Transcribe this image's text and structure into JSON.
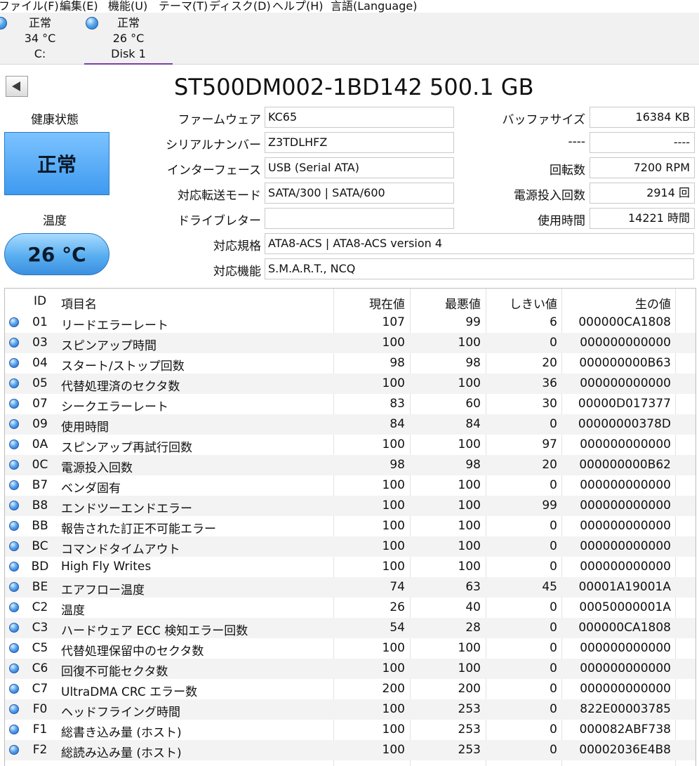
{
  "menu": [
    "ファイル(F)",
    "編集(E)",
    "機能(U)",
    "テーマ(T)",
    "ディスク(D)",
    "ヘルプ(H)",
    "言語(Language)"
  ],
  "disks": [
    {
      "status": "正常",
      "temp": "34 °C",
      "name": "C:"
    },
    {
      "status": "正常",
      "temp": "26 °C",
      "name": "Disk 1"
    }
  ],
  "colors": {
    "accent_tab": "#7a3fa8",
    "health_good": "#3e9af0",
    "status_dot": "#1c5fc2"
  },
  "title": "ST500DM002-1BD142 500.1 GB",
  "health": {
    "label": "健康状態",
    "value": "正常"
  },
  "temperature": {
    "label": "温度",
    "value": "26 °C"
  },
  "info": {
    "firmware": {
      "label": "ファームウェア",
      "value": "KC65"
    },
    "serial": {
      "label": "シリアルナンバー",
      "value": "Z3TDLHFZ"
    },
    "interface": {
      "label": "インターフェース",
      "value": "USB (Serial ATA)"
    },
    "transfer": {
      "label": "対応転送モード",
      "value": "SATA/300 | SATA/600"
    },
    "drive_letter": {
      "label": "ドライブレター",
      "value": ""
    },
    "standard": {
      "label": "対応規格",
      "value": "ATA8-ACS | ATA8-ACS version 4"
    },
    "features": {
      "label": "対応機能",
      "value": "S.M.A.R.T., NCQ"
    },
    "buffer": {
      "label": "バッファサイズ",
      "value": "16384 KB"
    },
    "blank": {
      "label": "----",
      "value": "----"
    },
    "rotation": {
      "label": "回転数",
      "value": "7200 RPM"
    },
    "power_count": {
      "label": "電源投入回数",
      "value": "2914 回"
    },
    "power_hours": {
      "label": "使用時間",
      "value": "14221 時間"
    }
  },
  "smart": {
    "headers": {
      "id": "ID",
      "name": "項目名",
      "current": "現在値",
      "worst": "最悪値",
      "threshold": "しきい値",
      "raw": "生の値"
    },
    "rows": [
      {
        "id": "01",
        "name": "リードエラーレート",
        "current": "107",
        "worst": "99",
        "threshold": "6",
        "raw": "000000CA1808"
      },
      {
        "id": "03",
        "name": "スピンアップ時間",
        "current": "100",
        "worst": "100",
        "threshold": "0",
        "raw": "000000000000"
      },
      {
        "id": "04",
        "name": "スタート/ストップ回数",
        "current": "98",
        "worst": "98",
        "threshold": "20",
        "raw": "000000000B63"
      },
      {
        "id": "05",
        "name": "代替処理済のセクタ数",
        "current": "100",
        "worst": "100",
        "threshold": "36",
        "raw": "000000000000"
      },
      {
        "id": "07",
        "name": "シークエラーレート",
        "current": "83",
        "worst": "60",
        "threshold": "30",
        "raw": "00000D017377"
      },
      {
        "id": "09",
        "name": "使用時間",
        "current": "84",
        "worst": "84",
        "threshold": "0",
        "raw": "00000000378D"
      },
      {
        "id": "0A",
        "name": "スピンアップ再試行回数",
        "current": "100",
        "worst": "100",
        "threshold": "97",
        "raw": "000000000000"
      },
      {
        "id": "0C",
        "name": "電源投入回数",
        "current": "98",
        "worst": "98",
        "threshold": "20",
        "raw": "000000000B62"
      },
      {
        "id": "B7",
        "name": "ベンダ固有",
        "current": "100",
        "worst": "100",
        "threshold": "0",
        "raw": "000000000000"
      },
      {
        "id": "B8",
        "name": "エンドツーエンドエラー",
        "current": "100",
        "worst": "100",
        "threshold": "99",
        "raw": "000000000000"
      },
      {
        "id": "BB",
        "name": "報告された訂正不可能エラー",
        "current": "100",
        "worst": "100",
        "threshold": "0",
        "raw": "000000000000"
      },
      {
        "id": "BC",
        "name": "コマンドタイムアウト",
        "current": "100",
        "worst": "100",
        "threshold": "0",
        "raw": "000000000000"
      },
      {
        "id": "BD",
        "name": "High Fly Writes",
        "current": "100",
        "worst": "100",
        "threshold": "0",
        "raw": "000000000000"
      },
      {
        "id": "BE",
        "name": "エアフロー温度",
        "current": "74",
        "worst": "63",
        "threshold": "45",
        "raw": "00001A19001A"
      },
      {
        "id": "C2",
        "name": "温度",
        "current": "26",
        "worst": "40",
        "threshold": "0",
        "raw": "00050000001A"
      },
      {
        "id": "C3",
        "name": "ハードウェア ECC 検知エラー回数",
        "current": "54",
        "worst": "28",
        "threshold": "0",
        "raw": "000000CA1808"
      },
      {
        "id": "C5",
        "name": "代替処理保留中のセクタ数",
        "current": "100",
        "worst": "100",
        "threshold": "0",
        "raw": "000000000000"
      },
      {
        "id": "C6",
        "name": "回復不可能セクタ数",
        "current": "100",
        "worst": "100",
        "threshold": "0",
        "raw": "000000000000"
      },
      {
        "id": "C7",
        "name": "UltraDMA CRC エラー数",
        "current": "200",
        "worst": "200",
        "threshold": "0",
        "raw": "000000000000"
      },
      {
        "id": "F0",
        "name": "ヘッドフライング時間",
        "current": "100",
        "worst": "253",
        "threshold": "0",
        "raw": "822E00003785"
      },
      {
        "id": "F1",
        "name": "総書き込み量 (ホスト)",
        "current": "100",
        "worst": "253",
        "threshold": "0",
        "raw": "000082ABF738"
      },
      {
        "id": "F2",
        "name": "総読み込み量 (ホスト)",
        "current": "100",
        "worst": "253",
        "threshold": "0",
        "raw": "00002036E4B8"
      }
    ]
  }
}
